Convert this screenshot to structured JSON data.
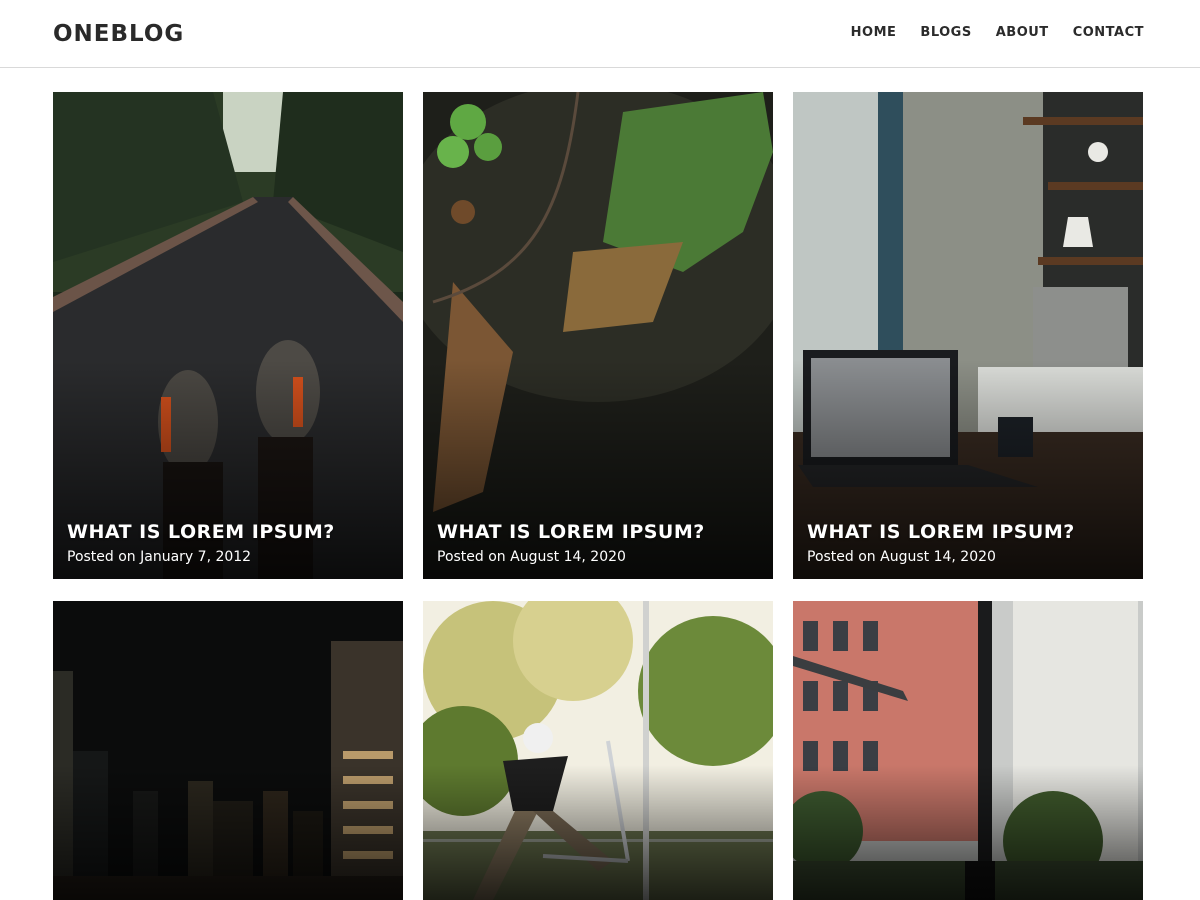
{
  "site": {
    "logo": "ONEBLOG"
  },
  "nav": {
    "home": "HOME",
    "blogs": "BLOGS",
    "about": "ABOUT",
    "contact": "CONTACT"
  },
  "posts": [
    {
      "title": "WHAT IS LOREM IPSUM?",
      "date": "Posted on January 7, 2012",
      "image": "forest-road-sneakers"
    },
    {
      "title": "WHAT IS LOREM IPSUM?",
      "date": "Posted on August 14, 2020",
      "image": "fern-on-rock"
    },
    {
      "title": "WHAT IS LOREM IPSUM?",
      "date": "Posted on August 14, 2020",
      "image": "laptop-kitchen-shelf"
    },
    {
      "image": "city-night-skyline"
    },
    {
      "image": "scooter-rider-trees"
    },
    {
      "image": "electric-scooter-buildings"
    }
  ]
}
